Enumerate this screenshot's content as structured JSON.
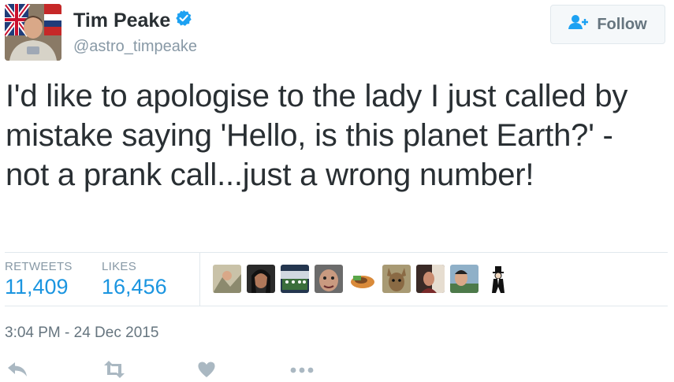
{
  "tweet": {
    "author": {
      "name": "Tim Peake",
      "handle": "@astro_timpeake",
      "verified_icon": "verified-badge-icon",
      "verified_color": "#1da1f2"
    },
    "follow_button": {
      "label": "Follow",
      "icon": "add-user-icon"
    },
    "text": "I'd like to apologise to the lady I just called by mistake saying 'Hello, is this planet Earth?' - not a prank call...just a wrong number!",
    "stats": {
      "retweets_label": "RETWEETS",
      "retweets_value": "11,409",
      "likes_label": "LIKES",
      "likes_value": "16,456"
    },
    "liked_by_avatars_count": 9,
    "timestamp": "3:04 PM - 24 Dec 2015",
    "actions": [
      "reply-icon",
      "retweet-icon",
      "like-icon",
      "more-icon"
    ]
  },
  "colors": {
    "accent": "#1b95e0",
    "muted": "#8899a6",
    "text": "#292f33",
    "divider": "#e1e8ed"
  }
}
